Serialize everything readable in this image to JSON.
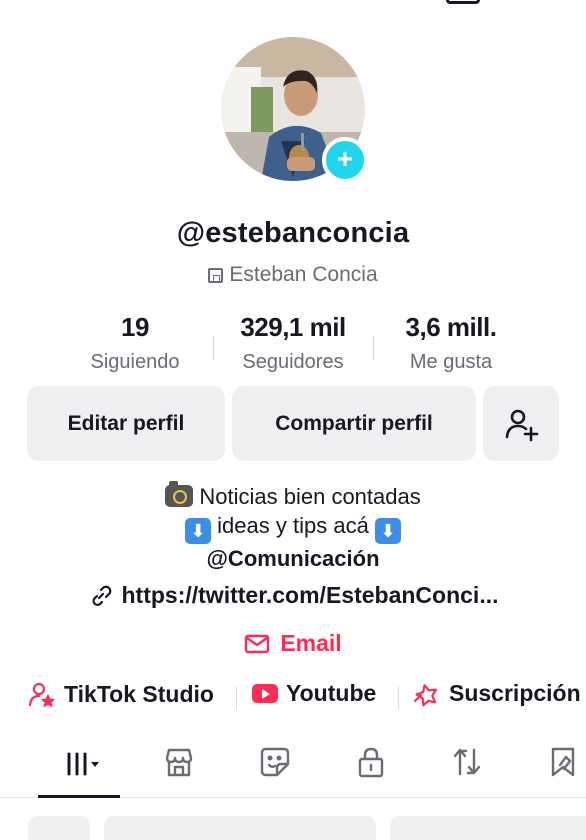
{
  "profile": {
    "username": "@estebanconcia",
    "display_name": "Esteban Concia"
  },
  "stats": [
    {
      "value": "19",
      "label": "Siguiendo"
    },
    {
      "value": "329,1 mil",
      "label": "Seguidores"
    },
    {
      "value": "3,6 mill.",
      "label": "Me gusta"
    }
  ],
  "actions": {
    "edit_label": "Editar perfil",
    "share_label": "Compartir perfil",
    "add_friend_icon": "person-plus-icon"
  },
  "bio": {
    "line1": "Noticias bien contadas",
    "line2": "ideas y tips acá",
    "line3": "@Comunicación",
    "arrow_glyph": "⬇"
  },
  "link": {
    "text": "https://twitter.com/EstebanConci..."
  },
  "email": {
    "label": "Email"
  },
  "extras": [
    {
      "label": "TikTok Studio",
      "icon": "creator-star-icon"
    },
    {
      "label": "Youtube",
      "icon": "youtube-icon"
    },
    {
      "label": "Suscripción",
      "icon": "subscription-icon"
    }
  ],
  "tabs": [
    {
      "name": "videos-grid",
      "icon": "grid-icon",
      "active": true
    },
    {
      "name": "shop",
      "icon": "store-icon"
    },
    {
      "name": "stickers",
      "icon": "sticker-icon"
    },
    {
      "name": "private",
      "icon": "lock-icon"
    },
    {
      "name": "reposts",
      "icon": "repost-icon"
    },
    {
      "name": "favorites",
      "icon": "bookmark-icon"
    }
  ],
  "colors": {
    "accent": "#fe2c55",
    "badge": "#20d5ec",
    "text": "#161823",
    "muted": "#6a6b73",
    "button_bg": "#efeff1"
  }
}
